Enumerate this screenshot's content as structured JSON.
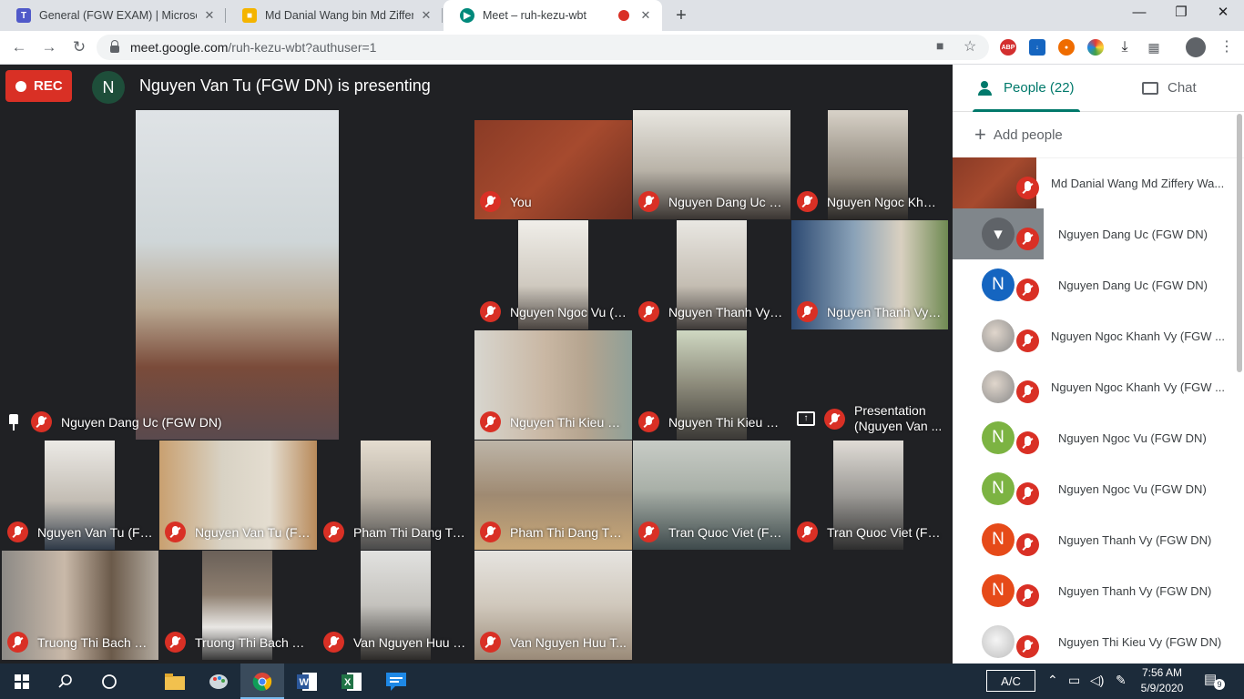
{
  "browser": {
    "tabs": [
      {
        "title": "General (FGW EXAM) | Microsoft",
        "icon": "teams-icon",
        "color": "#5059c9",
        "active": false
      },
      {
        "title": "Md Danial Wang bin Md Ziffery W",
        "icon": "slides-icon",
        "color": "#f4b400",
        "active": false
      },
      {
        "title": "Meet – ruh-kezu-wbt",
        "icon": "meet-icon",
        "color": "#00897b",
        "active": true
      }
    ],
    "url_host": "meet.google.com",
    "url_path": "/ruh-kezu-wbt?authuser=1",
    "extensions": [
      "ABP",
      "↓",
      "●",
      "●"
    ]
  },
  "meet": {
    "rec_label": "REC",
    "presenter_initial": "N",
    "presenting_text": "Nguyen Van Tu (FGW DN) is presenting",
    "main_tile_name": "Nguyen Dang Uc (FGW DN)",
    "tiles": [
      "You",
      "Nguyen Dang Uc (F...",
      "Nguyen Ngoc Khan...",
      "Nguyen Ngoc Vu (F...",
      "Nguyen Thanh Vy (...",
      "Nguyen Thanh Vy (...",
      "Nguyen Thi Kieu Vy...",
      "Nguyen Thi Kieu Vy...",
      "Nguyen Van Tu (FG...",
      "Nguyen Van Tu (FG...",
      "Pham Thi Dang Tuy...",
      "Pham Thi Dang Tuy...",
      "Tran Quoc Viet (FG...",
      "Tran Quoc Viet (FG...",
      "Truong Thi Bach Ye...",
      "Truong Thi Bach Ye...",
      "Van Nguyen Huu T...",
      "Van Nguyen Huu T..."
    ],
    "presentation_tile": {
      "line1": "Presentation",
      "line2": "(Nguyen Van ..."
    }
  },
  "panel": {
    "people_tab": "People (22)",
    "chat_tab": "Chat",
    "add_people": "Add people",
    "participants": [
      {
        "name": "Md Danial Wang Md Ziffery Wa...",
        "initial": "",
        "color": "#7a3b2e"
      },
      {
        "name": "Nguyen Dang Uc (FGW DN)",
        "initial": "",
        "color": "#5f6368"
      },
      {
        "name": "Nguyen Dang Uc (FGW DN)",
        "initial": "N",
        "color": "#1565c0"
      },
      {
        "name": "Nguyen Ngoc Khanh Vy (FGW ...",
        "initial": "",
        "color": "#9e9e9e"
      },
      {
        "name": "Nguyen Ngoc Khanh Vy (FGW ...",
        "initial": "",
        "color": "#9e9e9e"
      },
      {
        "name": "Nguyen Ngoc Vu (FGW DN)",
        "initial": "N",
        "color": "#7cb342"
      },
      {
        "name": "Nguyen Ngoc Vu (FGW DN)",
        "initial": "N",
        "color": "#7cb342"
      },
      {
        "name": "Nguyen Thanh Vy (FGW DN)",
        "initial": "N",
        "color": "#e64a19"
      },
      {
        "name": "Nguyen Thanh Vy (FGW DN)",
        "initial": "N",
        "color": "#e64a19"
      },
      {
        "name": "Nguyen Thi Kieu Vy (FGW DN)",
        "initial": "",
        "color": "#bdbdbd"
      }
    ]
  },
  "taskbar": {
    "ac_label": "A/C",
    "time": "7:56 AM",
    "date": "5/9/2020",
    "notification_count": "9"
  }
}
